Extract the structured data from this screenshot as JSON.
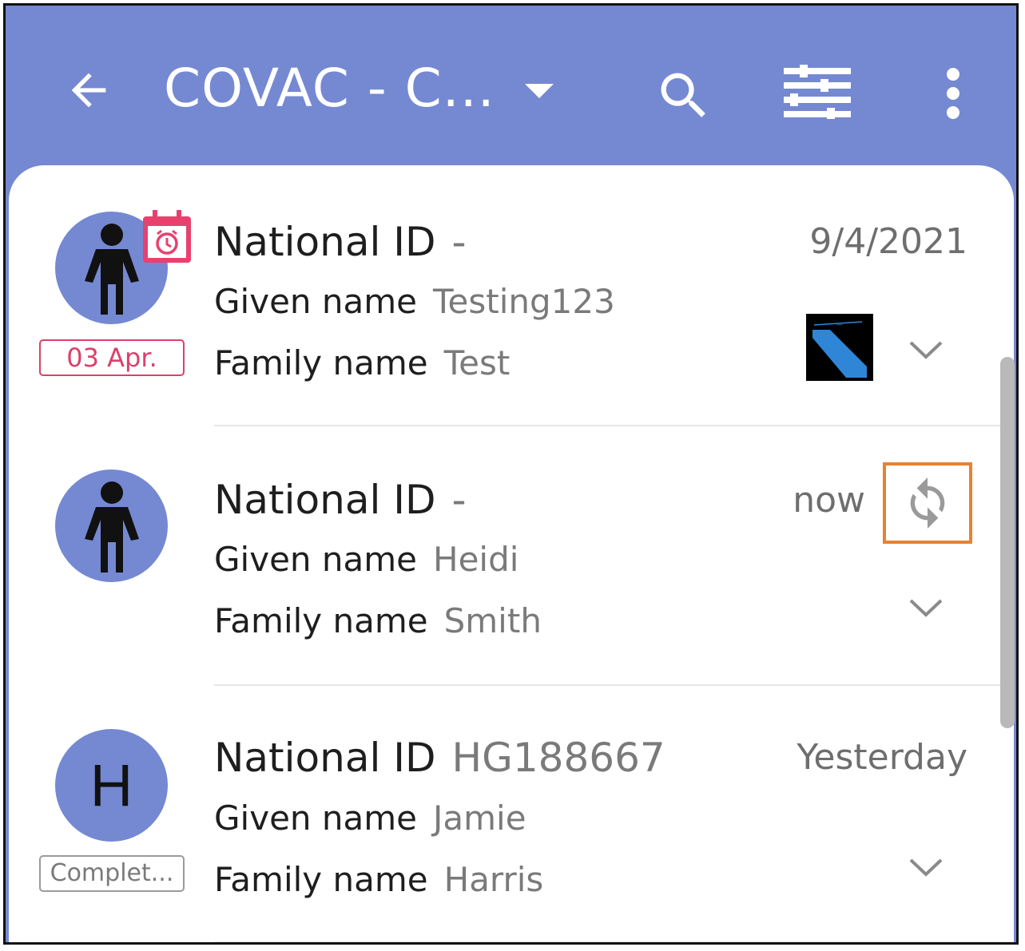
{
  "header": {
    "title": "COVAC - C...",
    "back_icon": "arrow-left-icon",
    "dropdown_icon": "caret-down-icon",
    "search_icon": "search-icon",
    "filter_icon": "filter-icon",
    "more_icon": "more-vert-icon",
    "bg_color": "#7588d2"
  },
  "records": [
    {
      "avatar_icon": "person-icon",
      "badge_icon": "calendar-alarm-icon",
      "chip": "03 Apr.",
      "line1_label": "National ID",
      "line1_value": "-",
      "line2_label": "Given name",
      "line2_value": "Testing123",
      "line3_label": "Family name",
      "line3_value": "Test",
      "date": "9/4/2021"
    },
    {
      "avatar_icon": "person-icon",
      "line1_label": "National ID",
      "line1_value": "-",
      "line2_label": "Given name",
      "line2_value": "Heidi",
      "line3_label": "Family name",
      "line3_value": "Smith",
      "date": "now",
      "sync_icon": "sync-icon"
    },
    {
      "avatar_letter": "H",
      "chip": "Complet...",
      "line1_label": "National ID",
      "line1_value": "HG188667",
      "line2_label": "Given name",
      "line2_value": "Jamie",
      "line3_label": "Family name",
      "line3_value": "Harris",
      "date": "Yesterday"
    }
  ],
  "colors": {
    "accent": "#7588d2",
    "alert": "#d9416a",
    "highlight": "#e8822f"
  }
}
